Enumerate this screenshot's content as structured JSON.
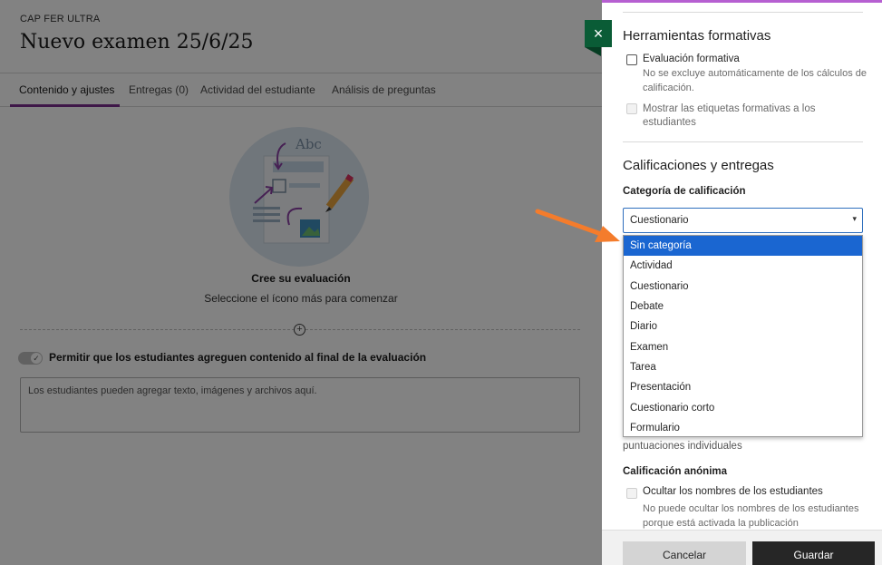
{
  "page": {
    "course": "CAP FER ULTRA",
    "title": "Nuevo examen 25/6/25",
    "tabs": [
      {
        "label": "Contenido y ajustes",
        "active": true
      },
      {
        "label": "Entregas (0)",
        "active": false
      },
      {
        "label": "Actividad del estudiante",
        "active": false
      },
      {
        "label": "Análisis de preguntas",
        "active": false
      }
    ],
    "illustration_text": "Abc",
    "empty_title": "Cree su evaluación",
    "empty_subtitle": "Seleccione el ícono más para comenzar",
    "add_symbol": "+",
    "toggle_check": "✓",
    "allow_toggle_label": "Permitir que los estudiantes agreguen contenido al final de la evaluación",
    "student_area_placeholder": "Los estudiantes pueden agregar texto, imágenes y archivos aquí."
  },
  "close_icon": "×",
  "panel": {
    "formative": {
      "heading": "Herramientas formativas",
      "evaluation_label": "Evaluación formativa",
      "evaluation_help": "No se excluye automáticamente de los cálculos de calificación.",
      "show_labels": "Mostrar las etiquetas formativas a los estudiantes"
    },
    "grading": {
      "heading": "Calificaciones y entregas",
      "category_label": "Categoría de calificación",
      "selected_value": "Cuestionario",
      "caret": "▾",
      "options": [
        "Sin categoría",
        "Actividad",
        "Cuestionario",
        "Debate",
        "Diario",
        "Examen",
        "Tarea",
        "Presentación",
        "Cuestionario corto",
        "Formulario"
      ],
      "highlighted_option": 0,
      "partial_text": "puntuaciones individuales"
    },
    "anonymous": {
      "heading": "Calificación anónima",
      "hide_names_label": "Ocultar los nombres de los estudiantes",
      "hide_names_help": "No puede ocultar los nombres de los estudiantes porque está activada la publicación"
    },
    "footer": {
      "cancel": "Cancelar",
      "save": "Guardar"
    }
  },
  "colors": {
    "accent_purple": "#7a2e8e",
    "close_green": "#0a5c36",
    "select_blue": "#1a66d1",
    "arrow_orange": "#f47c2c"
  }
}
